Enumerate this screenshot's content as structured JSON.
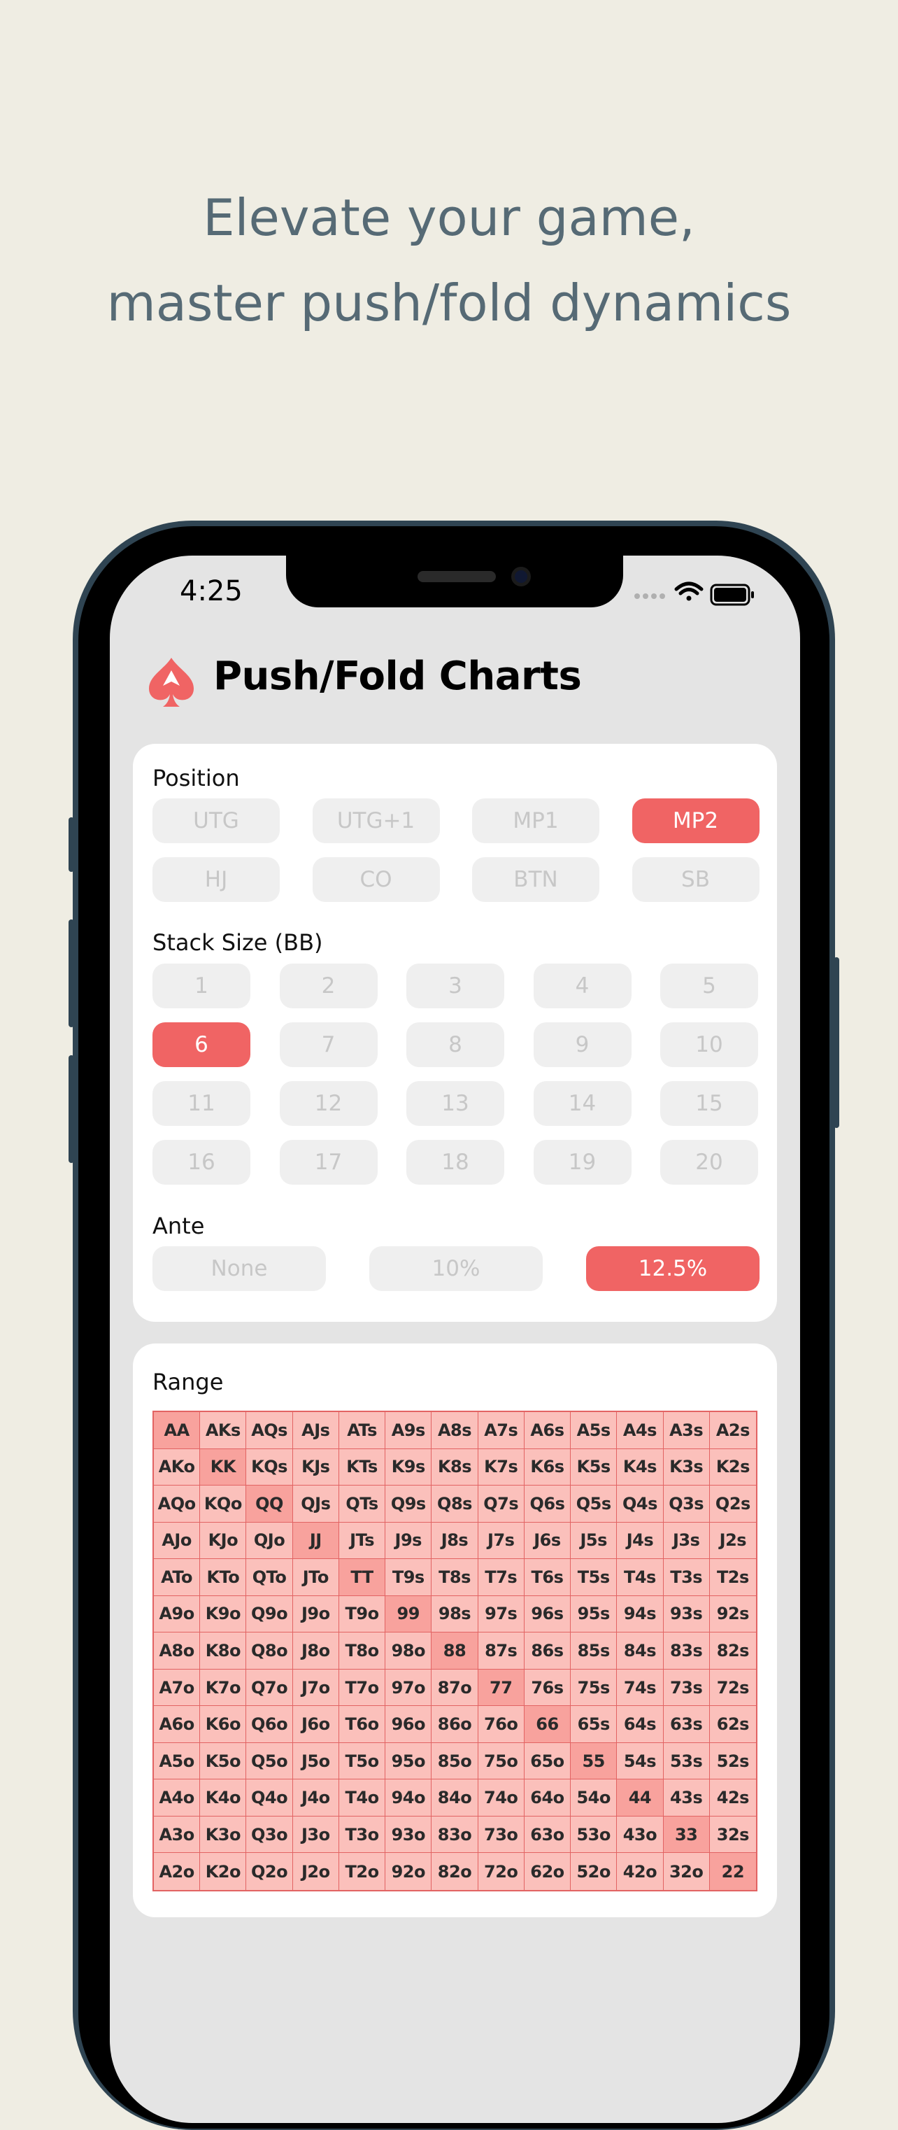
{
  "headline": {
    "line1": "Elevate your game,",
    "line2": "master push/fold dynamics"
  },
  "status_bar": {
    "time": "4:25"
  },
  "app": {
    "title": "Push/Fold Charts",
    "accent_color": "#f06464",
    "logo_icon": "spade-icon"
  },
  "position": {
    "label": "Position",
    "options": [
      "UTG",
      "UTG+1",
      "MP1",
      "MP2",
      "HJ",
      "CO",
      "BTN",
      "SB"
    ],
    "selected": "MP2"
  },
  "stack": {
    "label": "Stack Size (BB)",
    "options": [
      "1",
      "2",
      "3",
      "4",
      "5",
      "6",
      "7",
      "8",
      "9",
      "10",
      "11",
      "12",
      "13",
      "14",
      "15",
      "16",
      "17",
      "18",
      "19",
      "20"
    ],
    "selected": "6"
  },
  "ante": {
    "label": "Ante",
    "options": [
      "None",
      "10%",
      "12.5%"
    ],
    "selected": "12.5%"
  },
  "range": {
    "label": "Range",
    "rows": [
      [
        "AA",
        "AKs",
        "AQs",
        "AJs",
        "ATs",
        "A9s",
        "A8s",
        "A7s",
        "A6s",
        "A5s",
        "A4s",
        "A3s",
        "A2s"
      ],
      [
        "AKo",
        "KK",
        "KQs",
        "KJs",
        "KTs",
        "K9s",
        "K8s",
        "K7s",
        "K6s",
        "K5s",
        "K4s",
        "K3s",
        "K2s"
      ],
      [
        "AQo",
        "KQo",
        "QQ",
        "QJs",
        "QTs",
        "Q9s",
        "Q8s",
        "Q7s",
        "Q6s",
        "Q5s",
        "Q4s",
        "Q3s",
        "Q2s"
      ],
      [
        "AJo",
        "KJo",
        "QJo",
        "JJ",
        "JTs",
        "J9s",
        "J8s",
        "J7s",
        "J6s",
        "J5s",
        "J4s",
        "J3s",
        "J2s"
      ],
      [
        "ATo",
        "KTo",
        "QTo",
        "JTo",
        "TT",
        "T9s",
        "T8s",
        "T7s",
        "T6s",
        "T5s",
        "T4s",
        "T3s",
        "T2s"
      ],
      [
        "A9o",
        "K9o",
        "Q9o",
        "J9o",
        "T9o",
        "99",
        "98s",
        "97s",
        "96s",
        "95s",
        "94s",
        "93s",
        "92s"
      ],
      [
        "A8o",
        "K8o",
        "Q8o",
        "J8o",
        "T8o",
        "98o",
        "88",
        "87s",
        "86s",
        "85s",
        "84s",
        "83s",
        "82s"
      ],
      [
        "A7o",
        "K7o",
        "Q7o",
        "J7o",
        "T7o",
        "97o",
        "87o",
        "77",
        "76s",
        "75s",
        "74s",
        "73s",
        "72s"
      ],
      [
        "A6o",
        "K6o",
        "Q6o",
        "J6o",
        "T6o",
        "96o",
        "86o",
        "76o",
        "66",
        "65s",
        "64s",
        "63s",
        "62s"
      ],
      [
        "A5o",
        "K5o",
        "Q5o",
        "J5o",
        "T5o",
        "95o",
        "85o",
        "75o",
        "65o",
        "55",
        "54s",
        "53s",
        "52s"
      ],
      [
        "A4o",
        "K4o",
        "Q4o",
        "J4o",
        "T4o",
        "94o",
        "84o",
        "74o",
        "64o",
        "54o",
        "44",
        "43s",
        "42s"
      ],
      [
        "A3o",
        "K3o",
        "Q3o",
        "J3o",
        "T3o",
        "93o",
        "83o",
        "73o",
        "63o",
        "53o",
        "43o",
        "33",
        "32s"
      ],
      [
        "A2o",
        "K2o",
        "Q2o",
        "J2o",
        "T2o",
        "92o",
        "82o",
        "72o",
        "62o",
        "52o",
        "42o",
        "32o",
        "22"
      ]
    ]
  }
}
